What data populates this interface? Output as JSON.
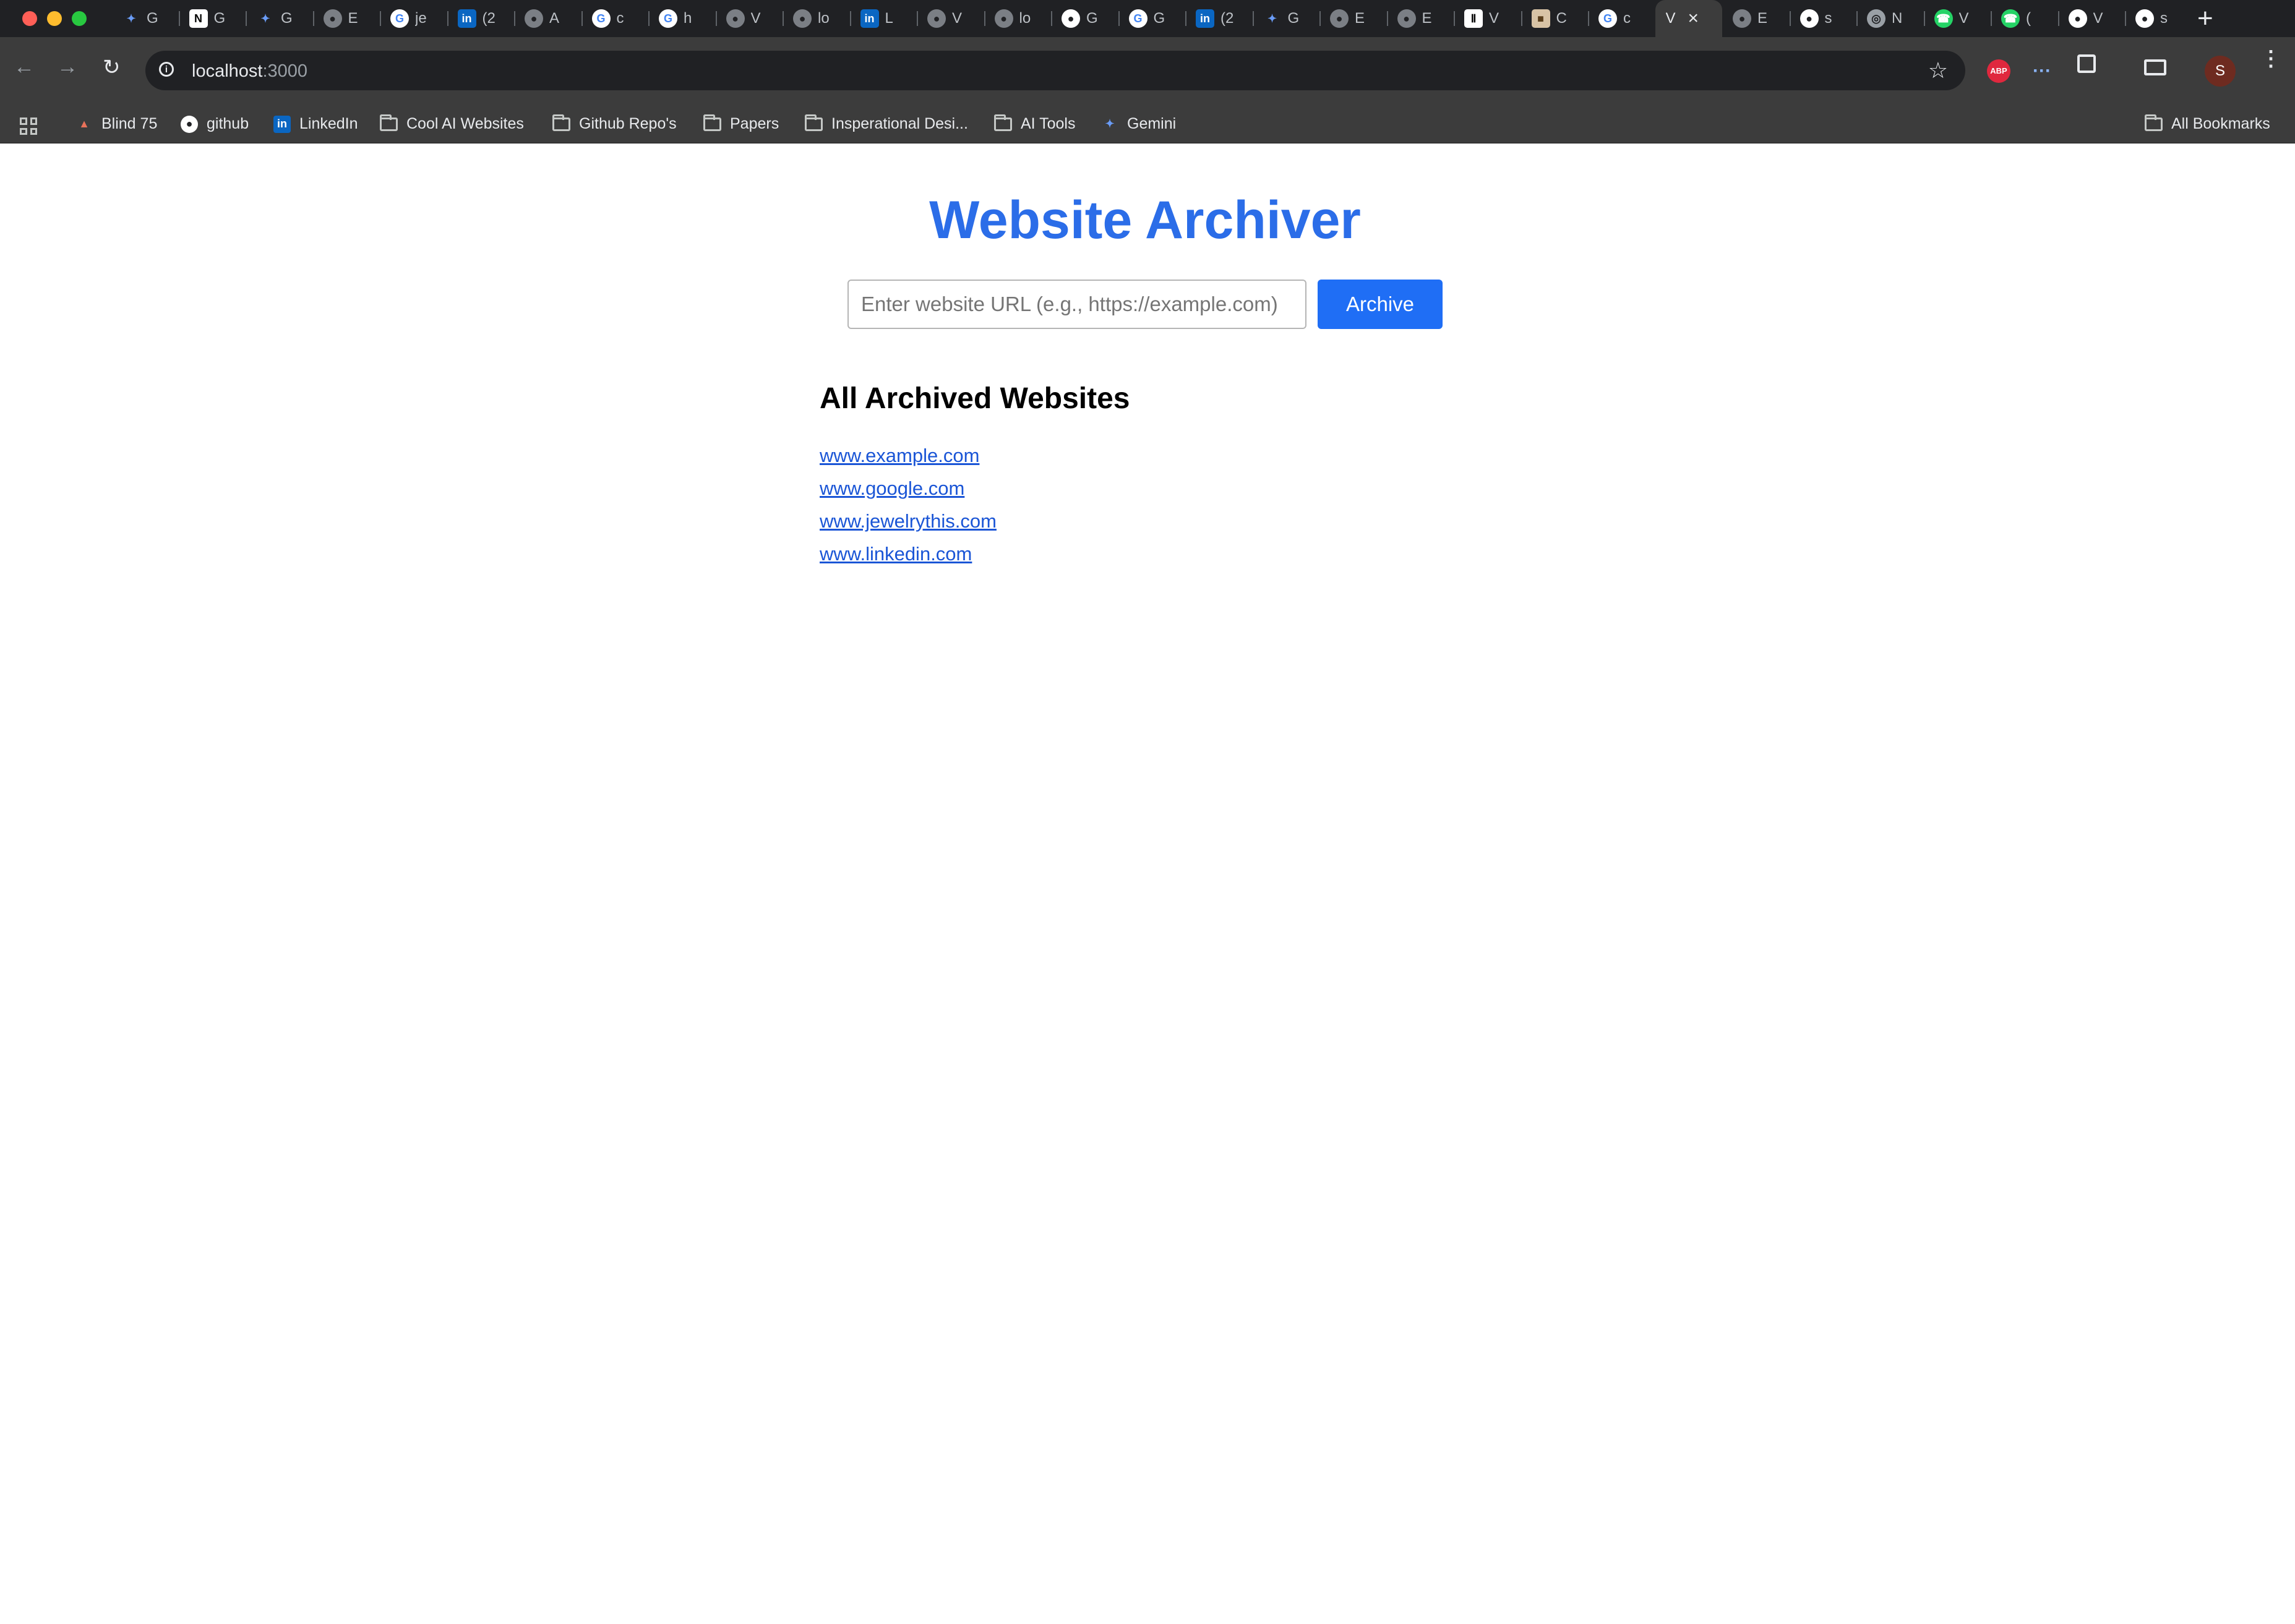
{
  "browser": {
    "tabs": [
      {
        "icon": "gemini-icon",
        "title": "G",
        "active": false
      },
      {
        "icon": "notion-icon",
        "title": "G",
        "active": false
      },
      {
        "icon": "gemini-icon",
        "title": "G",
        "active": false
      },
      {
        "icon": "globe-icon",
        "title": "E",
        "active": false
      },
      {
        "icon": "google-icon",
        "title": "je",
        "active": false
      },
      {
        "icon": "linkedin-icon",
        "title": "(2",
        "active": false
      },
      {
        "icon": "globe-icon",
        "title": "A",
        "active": false
      },
      {
        "icon": "google-icon",
        "title": "c",
        "active": false
      },
      {
        "icon": "google-icon",
        "title": "h",
        "active": false
      },
      {
        "icon": "globe-icon",
        "title": "V",
        "active": false
      },
      {
        "icon": "globe-icon",
        "title": "lo",
        "active": false
      },
      {
        "icon": "linkedin-icon",
        "title": "L",
        "active": false
      },
      {
        "icon": "globe-icon",
        "title": "V",
        "active": false
      },
      {
        "icon": "globe-icon",
        "title": "lo",
        "active": false
      },
      {
        "icon": "github-icon",
        "title": "G",
        "active": false
      },
      {
        "icon": "google-icon",
        "title": "G",
        "active": false
      },
      {
        "icon": "linkedin-icon",
        "title": "(2",
        "active": false
      },
      {
        "icon": "gemini-icon",
        "title": "G",
        "active": false
      },
      {
        "icon": "globe-icon",
        "title": "E",
        "active": false
      },
      {
        "icon": "globe-icon",
        "title": "E",
        "active": false
      },
      {
        "icon": "archive-icon",
        "title": "V",
        "active": false
      },
      {
        "icon": "app-icon",
        "title": "C",
        "active": false
      },
      {
        "icon": "google-icon",
        "title": "c",
        "active": false
      },
      {
        "icon": "none",
        "title": "V",
        "active": true
      },
      {
        "icon": "globe-icon",
        "title": "E",
        "active": false
      },
      {
        "icon": "github-icon",
        "title": "s",
        "active": false
      },
      {
        "icon": "chrome-icon",
        "title": "N",
        "active": false
      },
      {
        "icon": "whatsapp-icon",
        "title": "V",
        "active": false
      },
      {
        "icon": "whatsapp-icon",
        "title": "(",
        "active": false
      },
      {
        "icon": "github-icon",
        "title": "V",
        "active": false
      },
      {
        "icon": "github-icon",
        "title": "s",
        "active": false
      }
    ],
    "address_bar": {
      "host": "localhost",
      "port": ":3000"
    },
    "profile_initial": "S",
    "abp_label": "ABP",
    "bookmarks": [
      {
        "icon": "rocket-icon",
        "label": "Blind 75"
      },
      {
        "icon": "github-icon",
        "label": "github"
      },
      {
        "icon": "linkedin-icon",
        "label": "LinkedIn"
      },
      {
        "icon": "folder-icon",
        "label": "Cool AI Websites"
      },
      {
        "icon": "folder-icon",
        "label": "Github Repo's"
      },
      {
        "icon": "folder-icon",
        "label": "Papers"
      },
      {
        "icon": "folder-icon",
        "label": "Insperational Desi..."
      },
      {
        "icon": "folder-icon",
        "label": "AI Tools"
      },
      {
        "icon": "gemini-icon",
        "label": "Gemini"
      }
    ],
    "all_bookmarks_label": "All Bookmarks"
  },
  "app": {
    "title": "Website Archiver",
    "url_placeholder": "Enter website URL (e.g., https://example.com)",
    "archive_button": "Archive",
    "list_heading": "All Archived Websites",
    "archived_sites": [
      "www.example.com",
      "www.google.com",
      "www.jewelrythis.com",
      "www.linkedin.com"
    ]
  },
  "colors": {
    "title": "#2b6de8",
    "button": "#1f6ef5",
    "link": "#1a55d6"
  }
}
